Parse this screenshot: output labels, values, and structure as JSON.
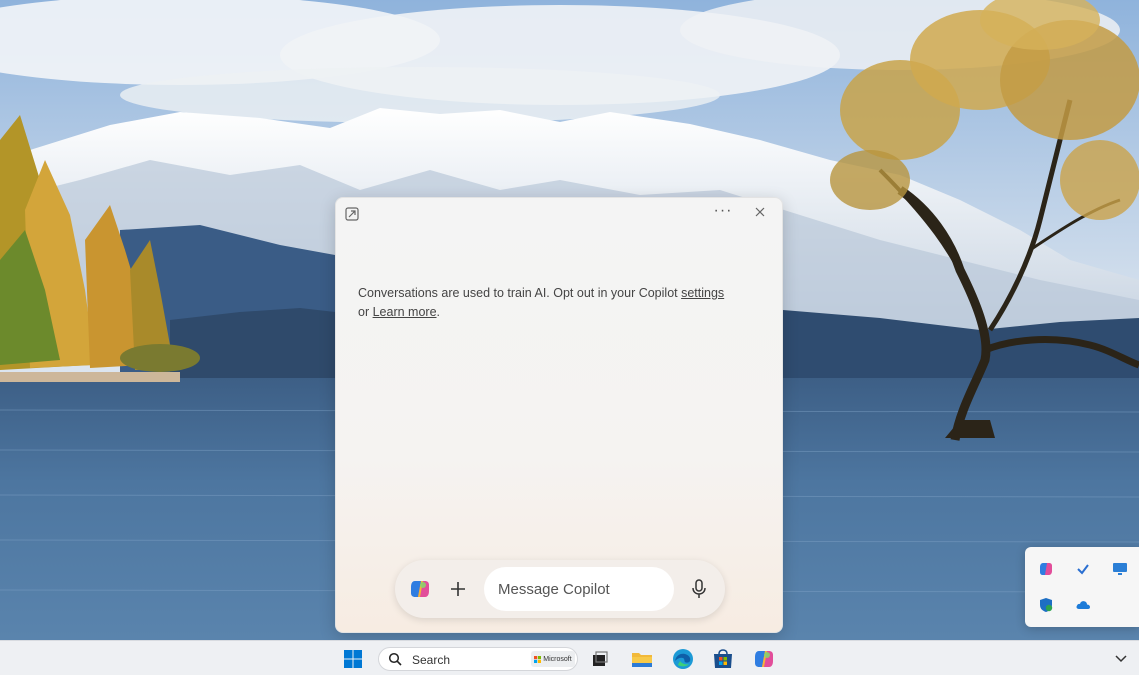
{
  "copilot": {
    "notice_text": "Conversations are used to train AI. Opt out in your Copilot ",
    "settings_link": "settings",
    "notice_or": "or ",
    "learn_more_link": "Learn more",
    "notice_end": ".",
    "more_label": "···",
    "input_placeholder": "Message Copilot"
  },
  "taskbar": {
    "search_label": "Search",
    "search_badge": "Microsoft",
    "pinned_icons": [
      "windows-start-icon",
      "task-view-icon",
      "file-explorer-icon",
      "edge-icon",
      "microsoft-store-icon",
      "copilot-icon"
    ]
  },
  "tray_flyout": {
    "icons": [
      "copilot-icon",
      "checkmark-icon",
      "monitor-icon",
      "defender-icon",
      "onedrive-icon"
    ]
  },
  "colors": {
    "window_bg": "#f4f4f4",
    "composer_bg": "#f3eeea",
    "taskbar_bg": "#eef0f3",
    "start_blue": "#0078d4"
  }
}
